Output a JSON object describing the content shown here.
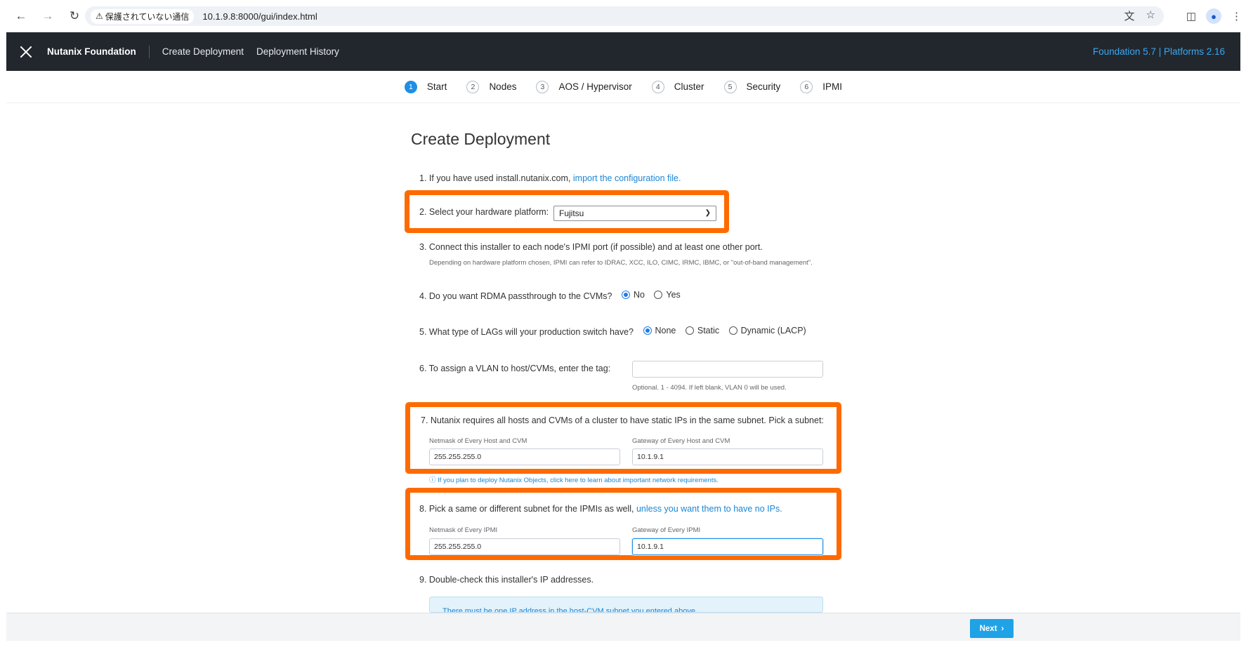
{
  "browser": {
    "security_label": "保護されていない通信",
    "url": "10.1.9.8:8000/gui/index.html"
  },
  "header": {
    "brand": "Nutanix Foundation",
    "nav": [
      "Create Deployment",
      "Deployment History"
    ],
    "version": "Foundation 5.7 | Platforms 2.16"
  },
  "steps": [
    {
      "num": "1",
      "label": "Start"
    },
    {
      "num": "2",
      "label": "Nodes"
    },
    {
      "num": "3",
      "label": "AOS / Hypervisor"
    },
    {
      "num": "4",
      "label": "Cluster"
    },
    {
      "num": "5",
      "label": "Security"
    },
    {
      "num": "6",
      "label": "IPMI"
    }
  ],
  "page_title": "Create Deployment",
  "q1": {
    "text": "1. If you have used install.nutanix.com,",
    "link": "import the configuration file."
  },
  "q2": {
    "text": "2. Select your hardware platform:",
    "selected": "Fujitsu"
  },
  "q3": {
    "text": "3. Connect this installer to each node's IPMI port (if possible) and at least one other port.",
    "hint": "Depending on hardware platform chosen, IPMI can refer to IDRAC, XCC, ILO, CIMC, IRMC, IBMC, or \"out-of-band management\"."
  },
  "q4": {
    "text": "4. Do you want RDMA passthrough to the CVMs?",
    "options": [
      "No",
      "Yes"
    ]
  },
  "q5": {
    "text": "5. What type of LAGs will your production switch have?",
    "options": [
      "None",
      "Static",
      "Dynamic (LACP)"
    ]
  },
  "q6": {
    "text": "6. To assign a VLAN to host/CVMs, enter the tag:",
    "value": "",
    "hint": "Optional. 1 - 4094. If left blank, VLAN 0 will be used."
  },
  "q7": {
    "text": "7. Nutanix requires all hosts and CVMs of a cluster to have static IPs in the same subnet. Pick a subnet:",
    "netmask_label": "Netmask of Every Host and CVM",
    "netmask_value": "255.255.255.0",
    "gateway_label": "Gateway of Every Host and CVM",
    "gateway_value": "10.1.9.1",
    "note": "ⓘ If you plan to deploy Nutanix Objects, click here to learn about important network requirements."
  },
  "q8": {
    "text": "8. Pick a same or different subnet for the IPMIs as well,",
    "link": "unless you want them to have no IPs.",
    "netmask_label": "Netmask of Every IPMI",
    "netmask_value": "255.255.255.0",
    "gateway_label": "Gateway of Every IPMI",
    "gateway_value": "10.1.9.1"
  },
  "q9": {
    "text": "9. Double-check this installer's IP addresses.",
    "alert_text": "There must be one IP address in the host-CVM subnet you entered above."
  },
  "footer": {
    "next_label": "Next"
  },
  "colors": {
    "highlight": "#ff6a00",
    "accent": "#1f8ee5",
    "header_bg": "#22272e"
  }
}
